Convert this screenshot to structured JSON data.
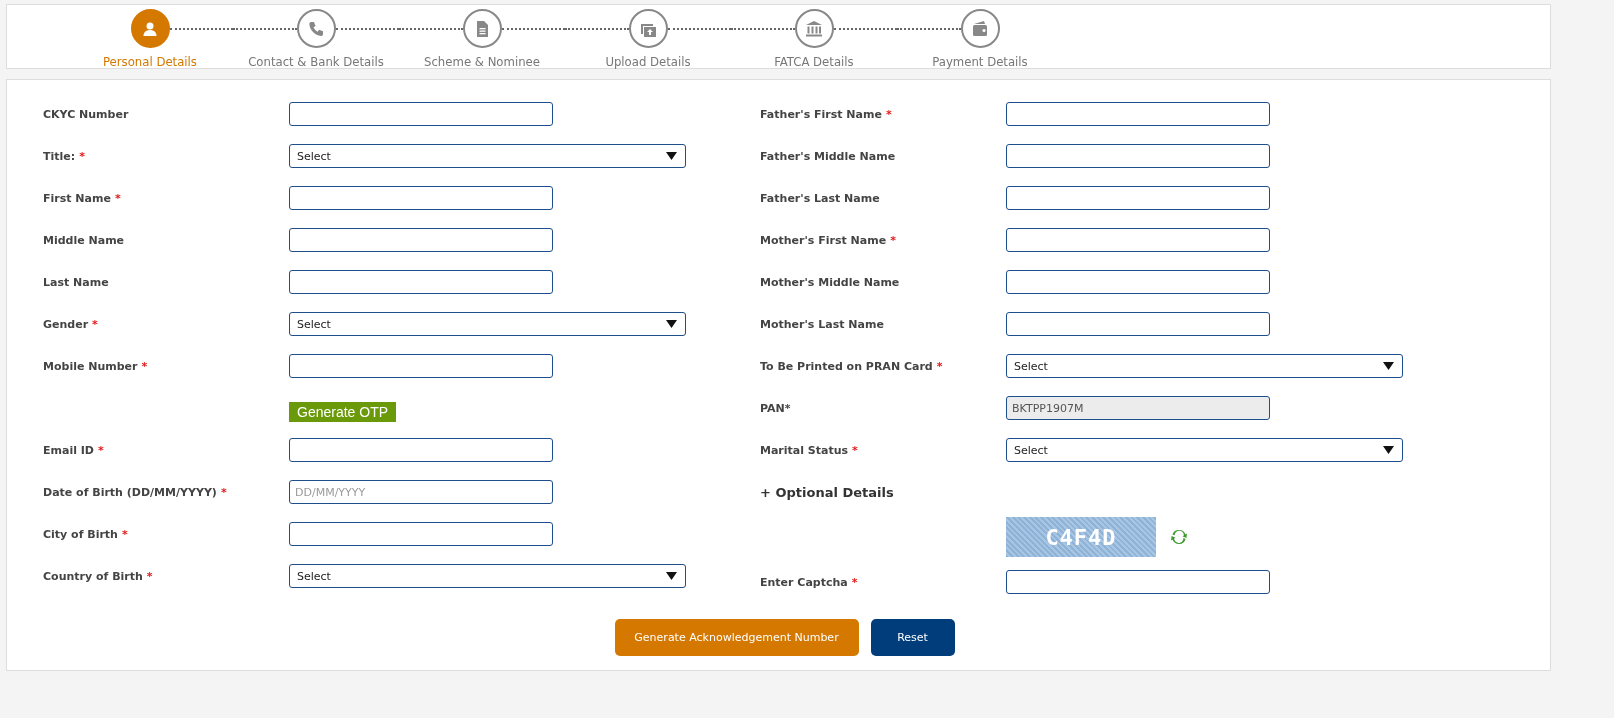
{
  "steps": [
    {
      "label": "Personal Details",
      "selected": true
    },
    {
      "label": "Contact & Bank Details",
      "selected": false
    },
    {
      "label": "Scheme & Nominee",
      "selected": false
    },
    {
      "label": "Upload Details",
      "selected": false
    },
    {
      "label": "FATCA Details",
      "selected": false
    },
    {
      "label": "Payment Details",
      "selected": false
    }
  ],
  "left_fields": [
    {
      "kind": "text",
      "label": "CKYC Number"
    },
    {
      "kind": "select",
      "label": "Title:",
      "mark": "*",
      "value": "Select"
    },
    {
      "kind": "text",
      "label": "First Name",
      "mark": "*"
    },
    {
      "kind": "text",
      "label": "Middle Name"
    },
    {
      "kind": "text",
      "label": "Last Name"
    },
    {
      "kind": "select",
      "label": "Gender",
      "mark": "*",
      "value": "Select"
    },
    {
      "kind": "text",
      "label": "Mobile Number",
      "mark": "*"
    },
    {
      "kind": "button",
      "text": "Generate OTP"
    },
    {
      "kind": "text",
      "label": "Email ID",
      "mark": "*"
    },
    {
      "kind": "text",
      "label": "Date of Birth (DD/MM/YYYY)",
      "mark": "*",
      "placeholder": "DD/MM/YYYY"
    },
    {
      "kind": "text",
      "label": "City of Birth",
      "mark": "*"
    },
    {
      "kind": "select",
      "label": "Country of Birth",
      "mark": "*",
      "value": "Select"
    }
  ],
  "right_fields": [
    {
      "kind": "text",
      "label": "Father's First Name",
      "mark": "*"
    },
    {
      "kind": "text",
      "label": "Father's Middle Name"
    },
    {
      "kind": "text",
      "label": "Father's Last Name"
    },
    {
      "kind": "text",
      "label": "Mother's First Name",
      "mark": "*"
    },
    {
      "kind": "text",
      "label": "Mother's Middle Name"
    },
    {
      "kind": "text",
      "label": "Mother's Last Name"
    },
    {
      "kind": "select",
      "label": "To Be Printed on PRAN Card",
      "mark": "*",
      "value": "Select"
    },
    {
      "kind": "readonly",
      "label": "PAN*",
      "value": "BKTPP1907M"
    },
    {
      "kind": "select",
      "label": "Marital Status",
      "mark": "*",
      "value": "Select"
    },
    {
      "kind": "toggle",
      "text": "+ Optional Details"
    },
    {
      "kind": "captcha",
      "text": "C4F4D"
    },
    {
      "kind": "text",
      "label": "Enter Captcha",
      "mark": "*"
    }
  ],
  "actions": [
    {
      "kind": "primary",
      "text": "Generate Acknowledgement Number"
    },
    {
      "kind": "secondary",
      "text": "Reset"
    }
  ]
}
